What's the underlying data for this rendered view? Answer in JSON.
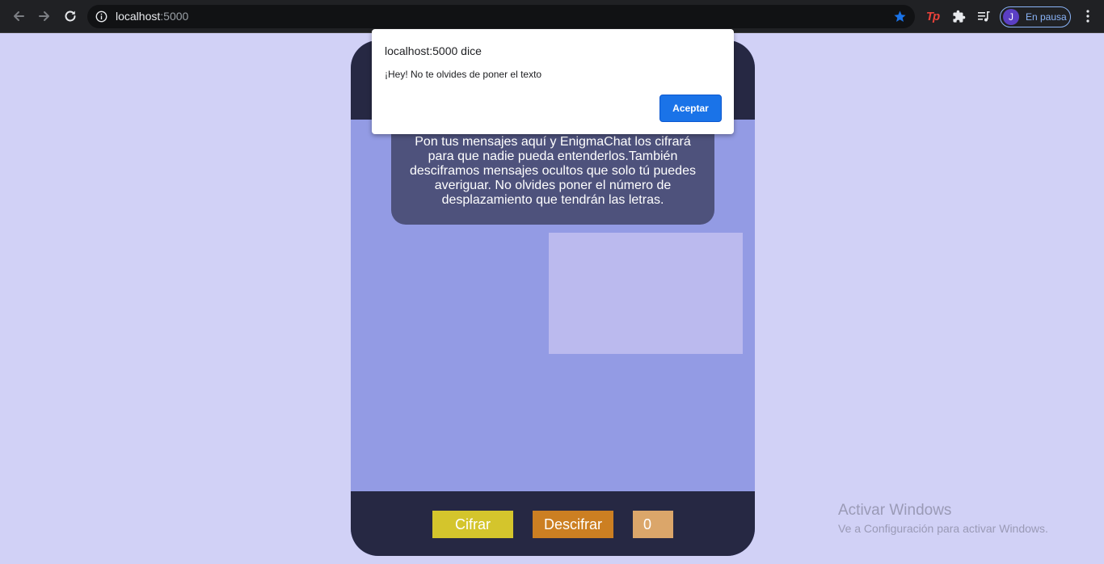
{
  "browser": {
    "url_host": "localhost",
    "url_port": ":5000",
    "profile_initial": "J",
    "profile_status": "En pausa",
    "extension_tp_label": "Tp",
    "icons": {
      "back": "arrow-left-icon",
      "forward": "arrow-right-icon",
      "reload": "reload-icon",
      "site_info": "info-icon",
      "bookmark": "star-icon",
      "extensions": "puzzle-icon",
      "media": "playlist-icon",
      "menu": "kebab-menu-icon"
    },
    "colors": {
      "chrome_bg": "#202124",
      "star": "#1a73e8",
      "profile_accent": "#8ab4f8"
    }
  },
  "app": {
    "description": "Pon tus mensajes aquí y EnigmaChat los cifrará para que nadie pueda entenderlos.También desciframos mensajes ocultos que solo tú puedes averiguar. No olvides poner el número de desplazamiento que tendrán las letras.",
    "message_value": "",
    "encrypt_label": "Cifrar",
    "decrypt_label": "Descifrar",
    "offset_value": "0",
    "colors": {
      "page_bg": "#d1d1f6",
      "card_bg": "#939be4",
      "header_footer_bg": "#262843",
      "desc_bg": "#4e527c",
      "textarea_bg": "#bbbaee",
      "encrypt_bg": "#d4c52c",
      "decrypt_bg": "#cc7f22",
      "offset_bg": "#dba66a"
    }
  },
  "dialog": {
    "title": "localhost:5000 dice",
    "message": "¡Hey! No te olvides de poner el texto",
    "ok_label": "Aceptar"
  },
  "watermark": {
    "title": "Activar Windows",
    "subtitle": "Ve a Configuración para activar Windows."
  }
}
